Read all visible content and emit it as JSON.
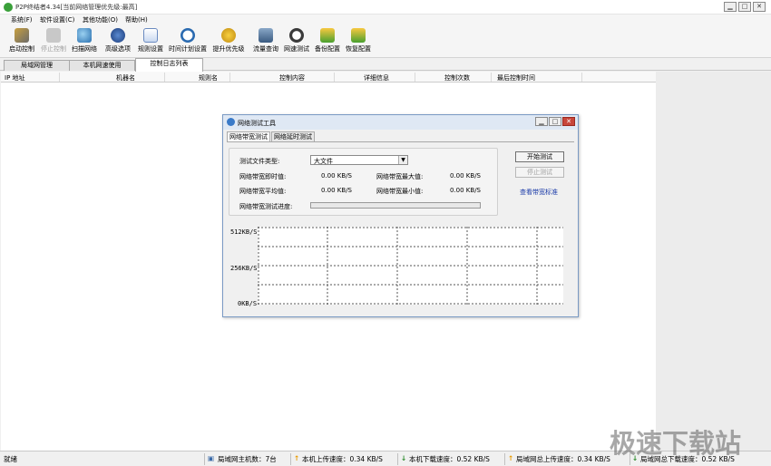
{
  "window": {
    "title": "P2P终结者4.34[当前网络管理优先级:最高]"
  },
  "menu": [
    "系统(F)",
    "软件设置(C)",
    "其他功能(O)",
    "帮助(H)"
  ],
  "toolbar": [
    {
      "label": "启动控制",
      "icon": "start-icon",
      "enabled": true
    },
    {
      "label": "停止控制",
      "icon": "stop-icon",
      "enabled": false
    },
    {
      "label": "扫描网络",
      "icon": "scan-icon",
      "enabled": true
    },
    {
      "label": "高级选项",
      "icon": "advanced-icon",
      "enabled": true
    },
    {
      "label": "规则设置",
      "icon": "rules-icon",
      "enabled": true
    },
    {
      "label": "时间计划设置",
      "icon": "clock-icon",
      "enabled": true
    },
    {
      "label": "提升优先级",
      "icon": "priority-icon",
      "enabled": true
    },
    {
      "label": "流量查询",
      "icon": "traffic-icon",
      "enabled": true
    },
    {
      "label": "网速测试",
      "icon": "speedtest-icon",
      "enabled": true
    },
    {
      "label": "备份配置",
      "icon": "backup-icon",
      "enabled": true
    },
    {
      "label": "恢复配置",
      "icon": "restore-icon",
      "enabled": true
    }
  ],
  "tabs": [
    {
      "label": "局域网管理",
      "active": false
    },
    {
      "label": "本机网速使用",
      "active": false
    },
    {
      "label": "控制日志列表",
      "active": true
    }
  ],
  "table": {
    "columns": [
      "IP 地址",
      "机器名",
      "规则名",
      "控制内容",
      "详细信息",
      "控制次数",
      "最后控制时间"
    ]
  },
  "dialog": {
    "title": "网络测试工具",
    "tabs": [
      "网络带宽测试",
      "网络延时测试"
    ],
    "file_type_label": "测试文件类型:",
    "file_type_value": "大文件",
    "instant_label": "网络带宽即时值:",
    "instant_value": "0.00 KB/S",
    "max_label": "网络带宽最大值:",
    "max_value": "0.00 KB/S",
    "avg_label": "网络带宽平均值:",
    "avg_value": "0.00 KB/S",
    "min_label": "网络带宽最小值:",
    "min_value": "0.00 KB/S",
    "progress_label": "网络带宽测试进度:",
    "progress": 0,
    "start_button": "开始测试",
    "stop_button": "停止测试",
    "view_link": "查看带宽标准",
    "graph": {
      "y_labels": [
        "512KB/S",
        "256KB/S",
        "0KB/S"
      ]
    }
  },
  "statusbar": {
    "status": "就绪",
    "hosts": "局域网主机数：7台",
    "local_up": "本机上传速度：0.34 KB/S",
    "local_down": "本机下载速度：0.52 KB/S",
    "lan_up": "局域网总上传速度：0.34 KB/S",
    "lan_down": "局域网总下载速度：0.52 KB/S"
  },
  "watermark": "极速下载站",
  "colors": {
    "accent": "#3aa03a",
    "link": "#1a3aa8",
    "up_arrow": "#e89a00",
    "down_arrow": "#2a8a2a"
  }
}
